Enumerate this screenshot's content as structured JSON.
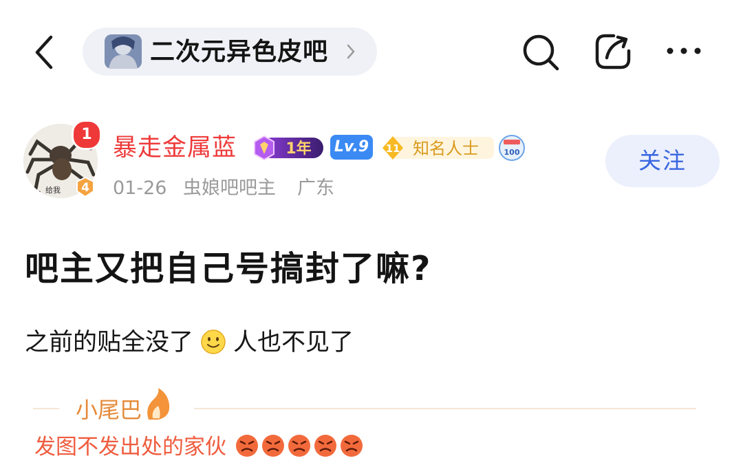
{
  "header": {
    "forum_name": "二次元异色皮吧",
    "icons": [
      "back-arrow-icon",
      "chevron-right-icon",
      "search-icon",
      "share-icon",
      "more-icon"
    ]
  },
  "author": {
    "name": "暴走金属蓝",
    "notification_count": "1",
    "avatar_level": "4",
    "avatar_caption": "蓝，给我",
    "badges": {
      "year": "1年",
      "level": "Lv.9",
      "fame_level": "11",
      "fame_title": "知名人士",
      "hundred": "100"
    },
    "date": "01-26",
    "role": "虫娘吧吧主",
    "location": "广东",
    "follow_label": "关注"
  },
  "post": {
    "title": "吧主又把自己号搞封了嘛?",
    "body_before_emoji": "之前的贴全没了",
    "body_after_emoji": "人也不见了"
  },
  "tail": {
    "label": "小尾巴",
    "text": "发图不发出处的家伙"
  },
  "colors": {
    "accent_blue": "#3966e0",
    "author_red": "#ee3a3a",
    "tail_orange": "#e58a3a",
    "gray_text": "#9a9a9a"
  }
}
